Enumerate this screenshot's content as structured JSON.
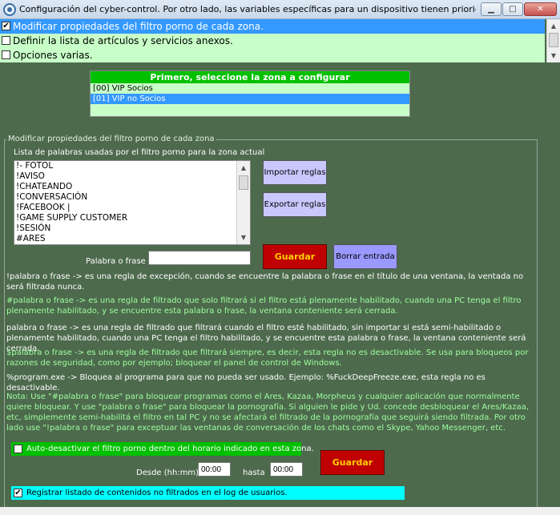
{
  "window": {
    "title": "Configuración del cyber-control. Por otro lado, las variables específicas para un dispositivo tienen priorida...",
    "min_label": "▁",
    "max_label": "□",
    "close_label": "✕"
  },
  "options": [
    {
      "label": "Modificar propiedades del filtro porno de cada zona.",
      "checked": true
    },
    {
      "label": "Definir la lista de artículos y servicios anexos.",
      "checked": false
    },
    {
      "label": "Opciones varias.",
      "checked": false
    }
  ],
  "zones": {
    "header": "Primero, seleccione la zona a configurar",
    "items": [
      "[00] VIP Socios",
      "[01] VIP no Socios"
    ],
    "selected_index": 1
  },
  "group": {
    "legend": "Modificar propiedades del filtro porno de cada zona",
    "list_label": "Lista de palabras usadas por el filtro porno para la zona actual",
    "words": [
      "!- FOTOL",
      "!AVISO",
      "!CHATEANDO",
      "!CONVERSACIÓN",
      "!FACEBOOK |",
      "!GAME SUPPLY CUSTOMER",
      "!SESIÓN",
      "#ARES"
    ],
    "import_label": "Importar reglas",
    "export_label": "Exportar reglas",
    "phrase_label": "Palabra o frase",
    "phrase_value": "",
    "save_label": "Guardar",
    "delete_label": "Borrar entrada"
  },
  "rules": [
    "!palabra o frase     ->  es una regla de excepción, cuando se encuentre la palabra o frase en el título de una ventana, la ventada no será filtrada nunca.",
    "#palabra o frase     ->  es una regla de filtrado que solo filtrará si el filtro está plenamente habilitado, cuando una PC tenga el filtro plenamente habilitado, y se encuentre esta palabra o frase, la ventana conteniente será cerrada.",
    "palabra o frase      ->  es una regla de filtrado que filtrará cuando el filtro esté habilitado, sin importar si está semi-habilitado o plenamente habilitado, cuando una PC tenga el filtro habilitado, y se encuentre esta palabra o frase, la ventana conteniente será cerrada.",
    "$palabra o frase     ->  es una regla de filtrado que filtrará siempre, es decir, esta regla no es desactivable. Se usa para bloqueos por razones de seguridad, como por ejemplo; bloquear el panel de control de Windows.",
    "%program.exe     -> Bloquea al programa para que no pueda ser usado. Ejemplo: %FuckDeepFreeze.exe, esta regla no es desactivable.",
    "Nota: Use \"#palabra o frase\" para bloquear programas como el Ares, Kazaa, Morpheus y cualquier aplicación que normalmente quiere bloquear. Y use \"palabra o frase\" para bloquear la pornografía. Si alguien le pide y Ud. concede desbloquear el Ares/Kazaa, etc, simplemente semi-habilitá el filtro en tal PC y no se afectará el filtrado de la pornografía que seguirá siendo filtrada. Por otro lado use \"!palabra o frase\" para exceptuar las ventanas de conversación de los chats como el Skype, Yahoo Messenger, etc."
  ],
  "schedule": {
    "auto_label": "Auto-desactivar el filtro porno dentro del horario indicado en esta zona.",
    "auto_checked": false,
    "from_label": "Desde (hh:mm)",
    "from_value": "00:00",
    "to_label": "hasta",
    "to_value": "00:00",
    "save_label": "Guardar"
  },
  "log": {
    "label": "Registrar listado de contenidos no filtrados en el log de usuarios.",
    "checked": true
  },
  "colors": {
    "background": "#4d6a4d",
    "selection": "#3399ff",
    "zone_header": "#00c000",
    "save_button": "#c00000",
    "log_bar": "#00ffff"
  }
}
